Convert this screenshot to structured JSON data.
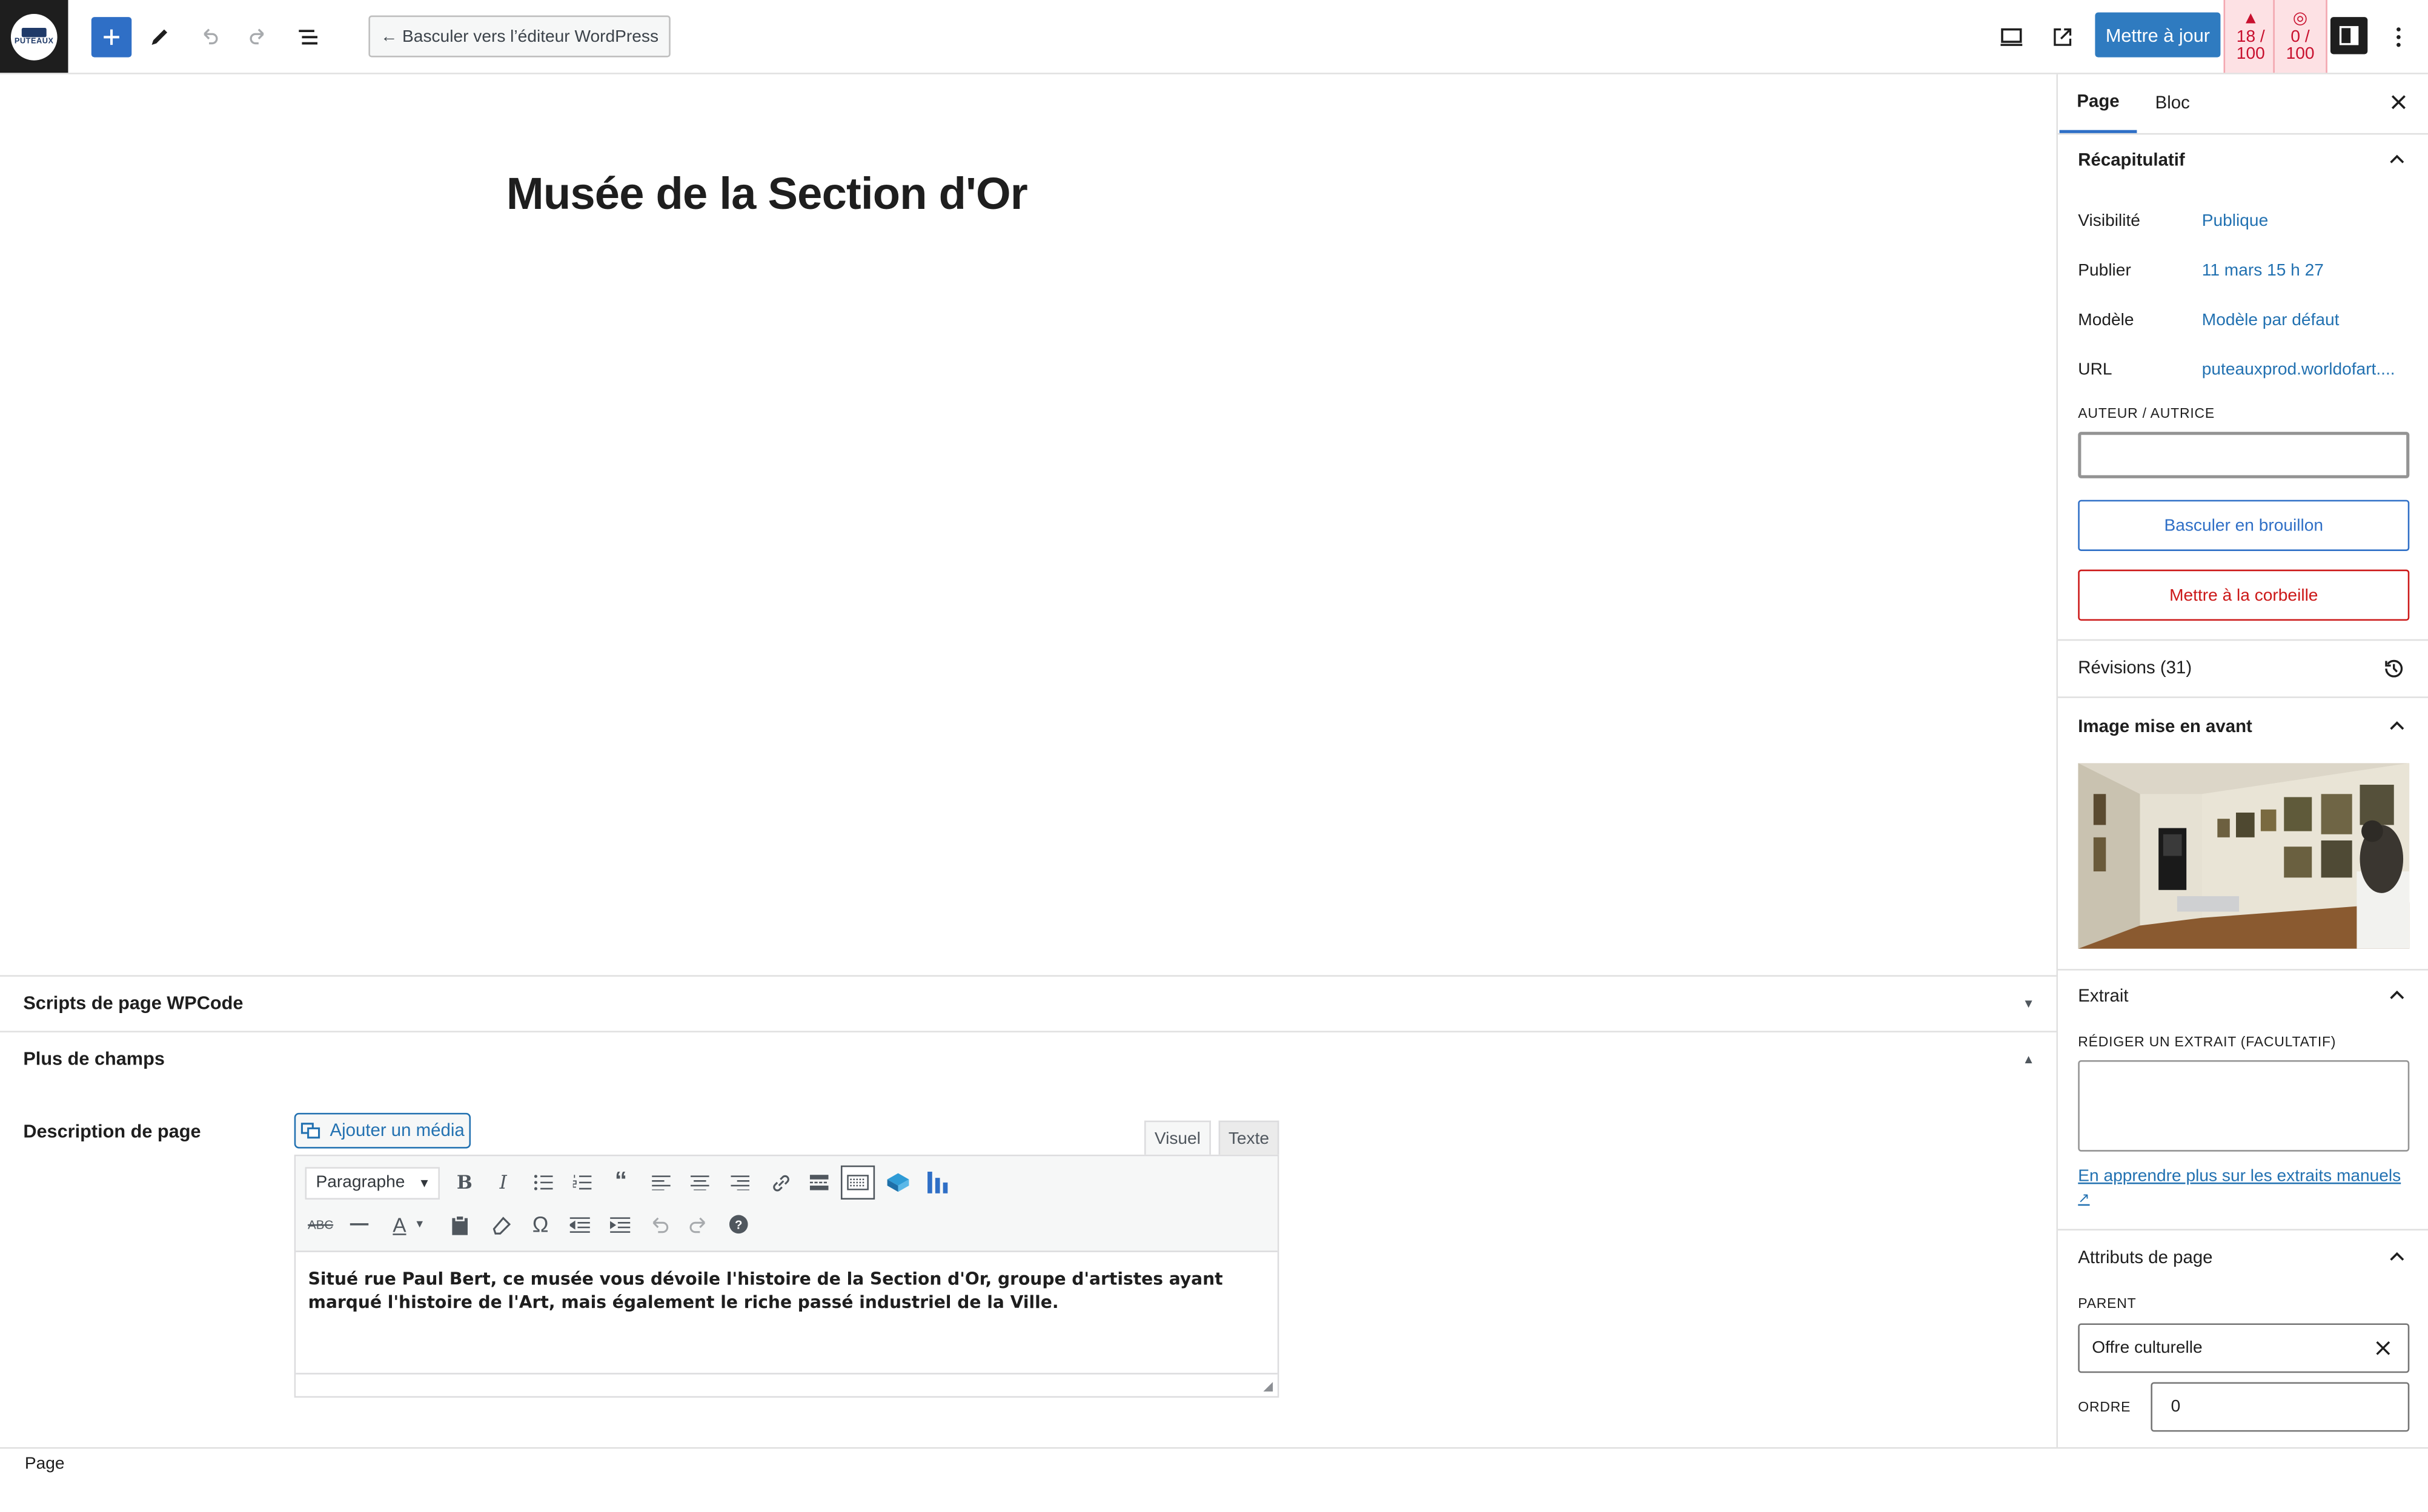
{
  "header": {
    "logo_text": "PUTEAUX",
    "switch_editor_label": "← Basculer vers l’éditeur WordPress",
    "update_label": "Mettre à jour",
    "score_seo": "18 / 100",
    "score_readability": "0 / 100"
  },
  "editor": {
    "title": "Musée de la Section d'Or"
  },
  "metaboxes": {
    "scripts_title": "Scripts de page WPCode",
    "more_fields_title": "Plus de champs",
    "description_label": "Description de page",
    "add_media_label": "Ajouter un média",
    "tab_visual": "Visuel",
    "tab_text": "Texte",
    "format_select": "Paragraphe",
    "content": "Situé rue Paul Bert, ce musée vous dévoile l'histoire de la Section d'Or, groupe d'artistes ayant marqué l'histoire de l'Art, mais également le riche passé industriel de la Ville."
  },
  "footer": {
    "breadcrumb": "Page"
  },
  "sidebar": {
    "tab_page": "Page",
    "tab_block": "Bloc",
    "summary_title": "Récapitulatif",
    "visibility_label": "Visibilité",
    "visibility_value": "Publique",
    "publish_label": "Publier",
    "publish_value": "11 mars 15 h 27",
    "template_label": "Modèle",
    "template_value": "Modèle par défaut",
    "url_label": "URL",
    "url_value": "puteauxprod.worldofart....",
    "author_caption": "AUTEUR / AUTRICE",
    "author_value": "",
    "draft_button": "Basculer en brouillon",
    "trash_button": "Mettre à la corbeille",
    "revisions_title": "Révisions (31)",
    "featured_title": "Image mise en avant",
    "excerpt_title": "Extrait",
    "excerpt_caption": "RÉDIGER UN EXTRAIT (FACULTATIF)",
    "excerpt_value": "",
    "excerpt_link": "En apprendre plus sur les extraits manuels",
    "attributes_title": "Attributs de page",
    "parent_caption": "PARENT",
    "parent_value": "Offre culturelle",
    "order_caption": "ORDRE",
    "order_value": "0"
  },
  "colors": {
    "accent": "#2f6fc6",
    "danger": "#cc1818",
    "score_bg": "#fde1e4",
    "score_text": "#c8102e"
  },
  "icons": [
    "plus-icon",
    "pencil-icon",
    "undo-icon",
    "redo-icon",
    "list-view-icon",
    "desktop-preview-icon",
    "external-link-icon",
    "sidebar-toggle-icon",
    "more-vertical-icon",
    "close-icon",
    "chevron-up-icon",
    "history-icon",
    "media-icon"
  ]
}
